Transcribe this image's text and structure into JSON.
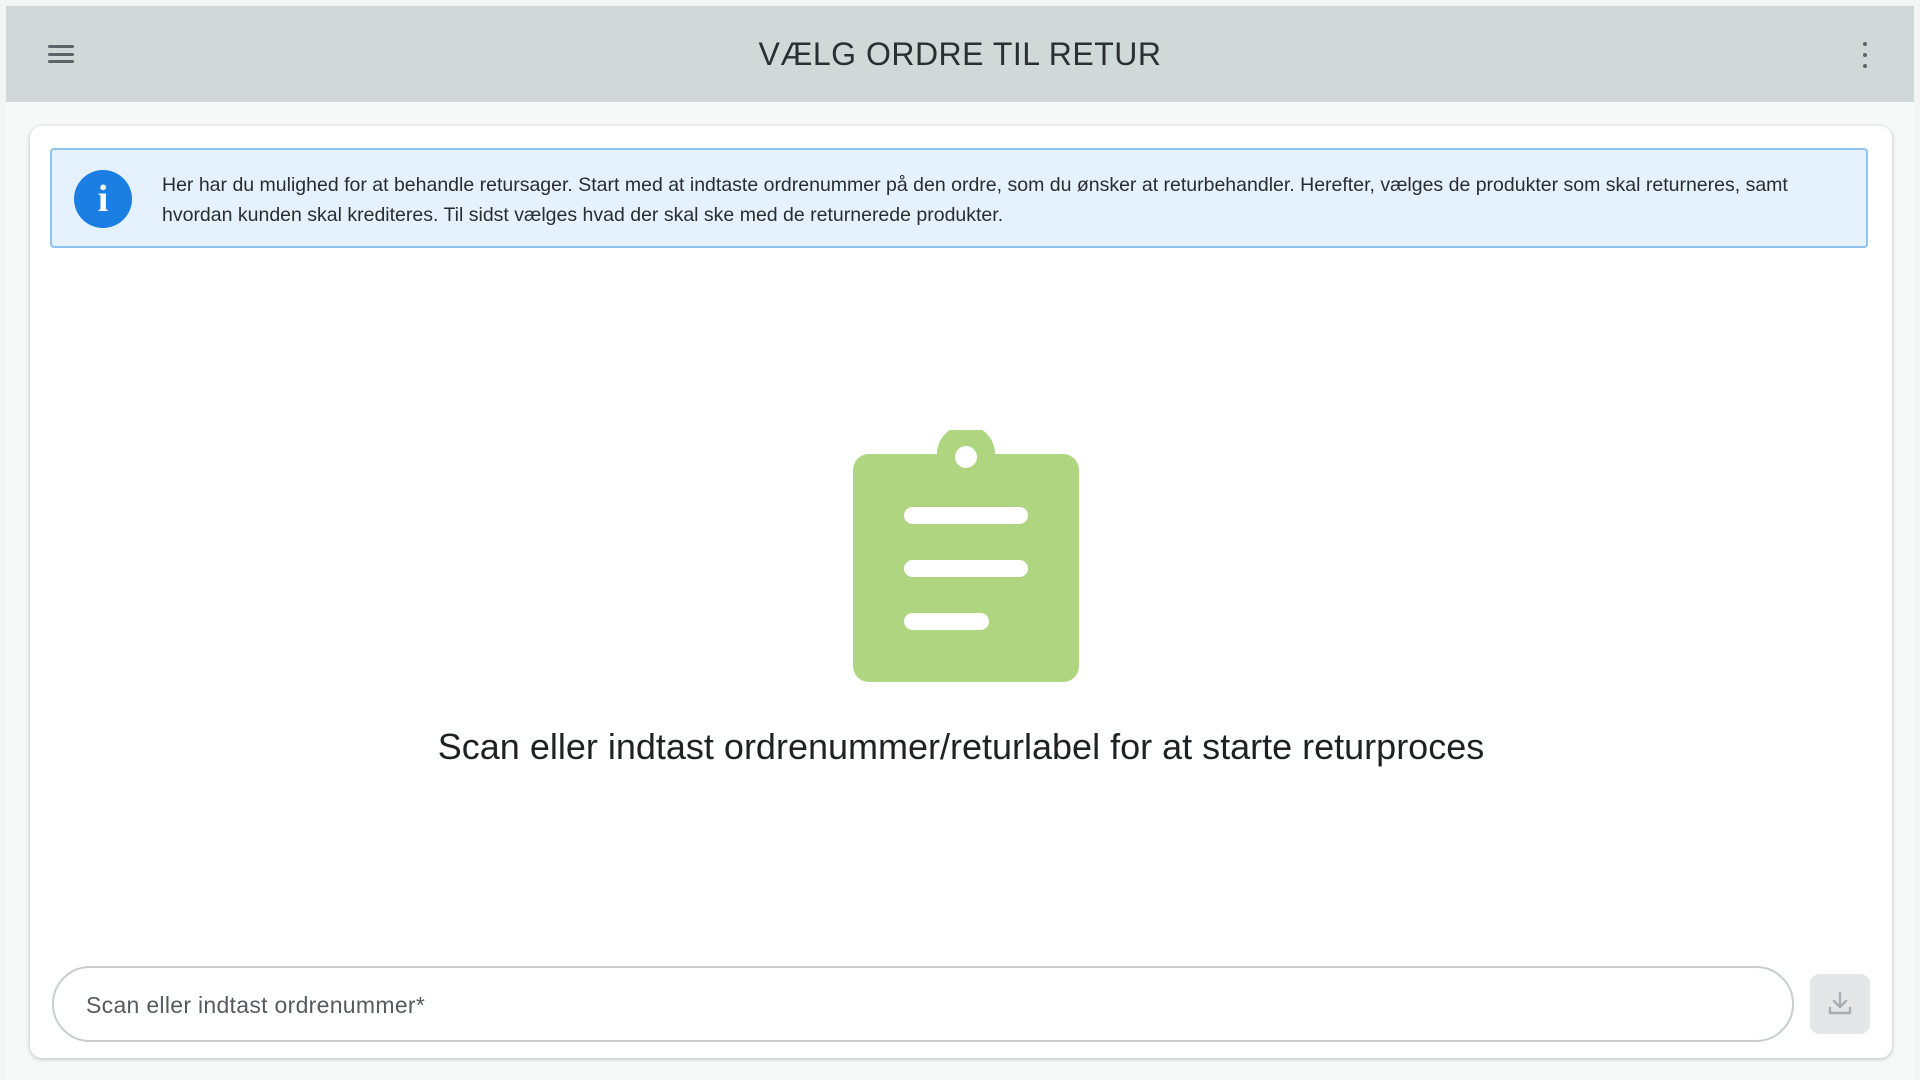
{
  "header": {
    "title": "VÆLG ORDRE TIL RETUR",
    "menu_icon": "hamburger-menu-icon",
    "more_icon": "kebab-more-icon"
  },
  "info": {
    "icon": "info-icon",
    "icon_glyph": "i",
    "text": "Her har du mulighed for at behandle retursager. Start med at indtaste ordrenummer på den ordre, som du ønsker at returbehandler. Herefter, vælges de produkter som skal returneres, samt hvordan kunden skal krediteres. Til sidst vælges hvad der skal ske med de returnerede produkter."
  },
  "empty_state": {
    "icon": "clipboard-icon",
    "message": "Scan eller indtast ordrenummer/returlabel for at starte returproces"
  },
  "order_input": {
    "value": "",
    "placeholder": "Scan eller indtast ordrenummer*",
    "submit_icon": "download-icon"
  },
  "colors": {
    "header_bg": "#d0d8d8",
    "info_bg": "#e5f1fd",
    "info_border": "#8ec3ef",
    "info_icon": "#1a7ee2",
    "clipboard": "#afd580"
  }
}
